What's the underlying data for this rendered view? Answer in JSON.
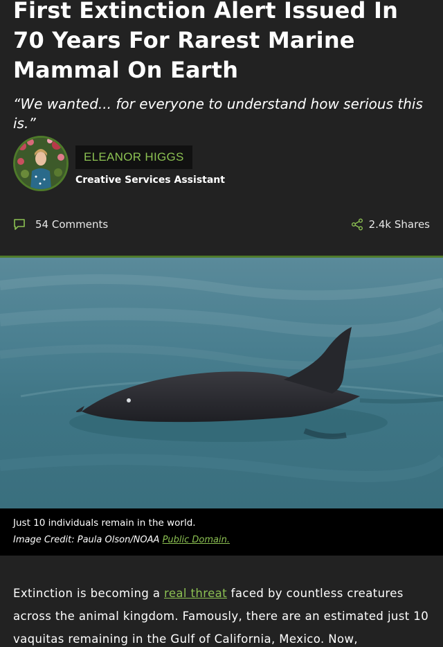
{
  "article": {
    "headline": "First Extinction Alert Issued In 70 Years For Rarest Marine Mammal On Earth",
    "subtitle": "“We wanted... for everyone to understand how serious this is.”"
  },
  "author": {
    "name": "ELEANOR HIGGS",
    "role": "Creative Services Assistant"
  },
  "stats": {
    "comments_icon": "comment-icon",
    "comments_label": "54 Comments",
    "shares_icon": "share-icon",
    "shares_label": "2.4k Shares"
  },
  "image": {
    "caption": "Just 10 individuals remain in the world.",
    "credit_prefix": "Image Credit: Paula Olson/NOAA",
    "credit_link": "Public Domain."
  },
  "body": {
    "text_before_link": "Extinction is becoming a ",
    "link_text": "real threat",
    "text_after_link": " faced by countless creatures across the animal kingdom. Famously, there are an estimated just 10 vaquitas remaining in the Gulf of California, Mexico. Now,"
  },
  "colors": {
    "background": "#222222",
    "accent": "#8cc152",
    "caption_background": "#000000"
  }
}
